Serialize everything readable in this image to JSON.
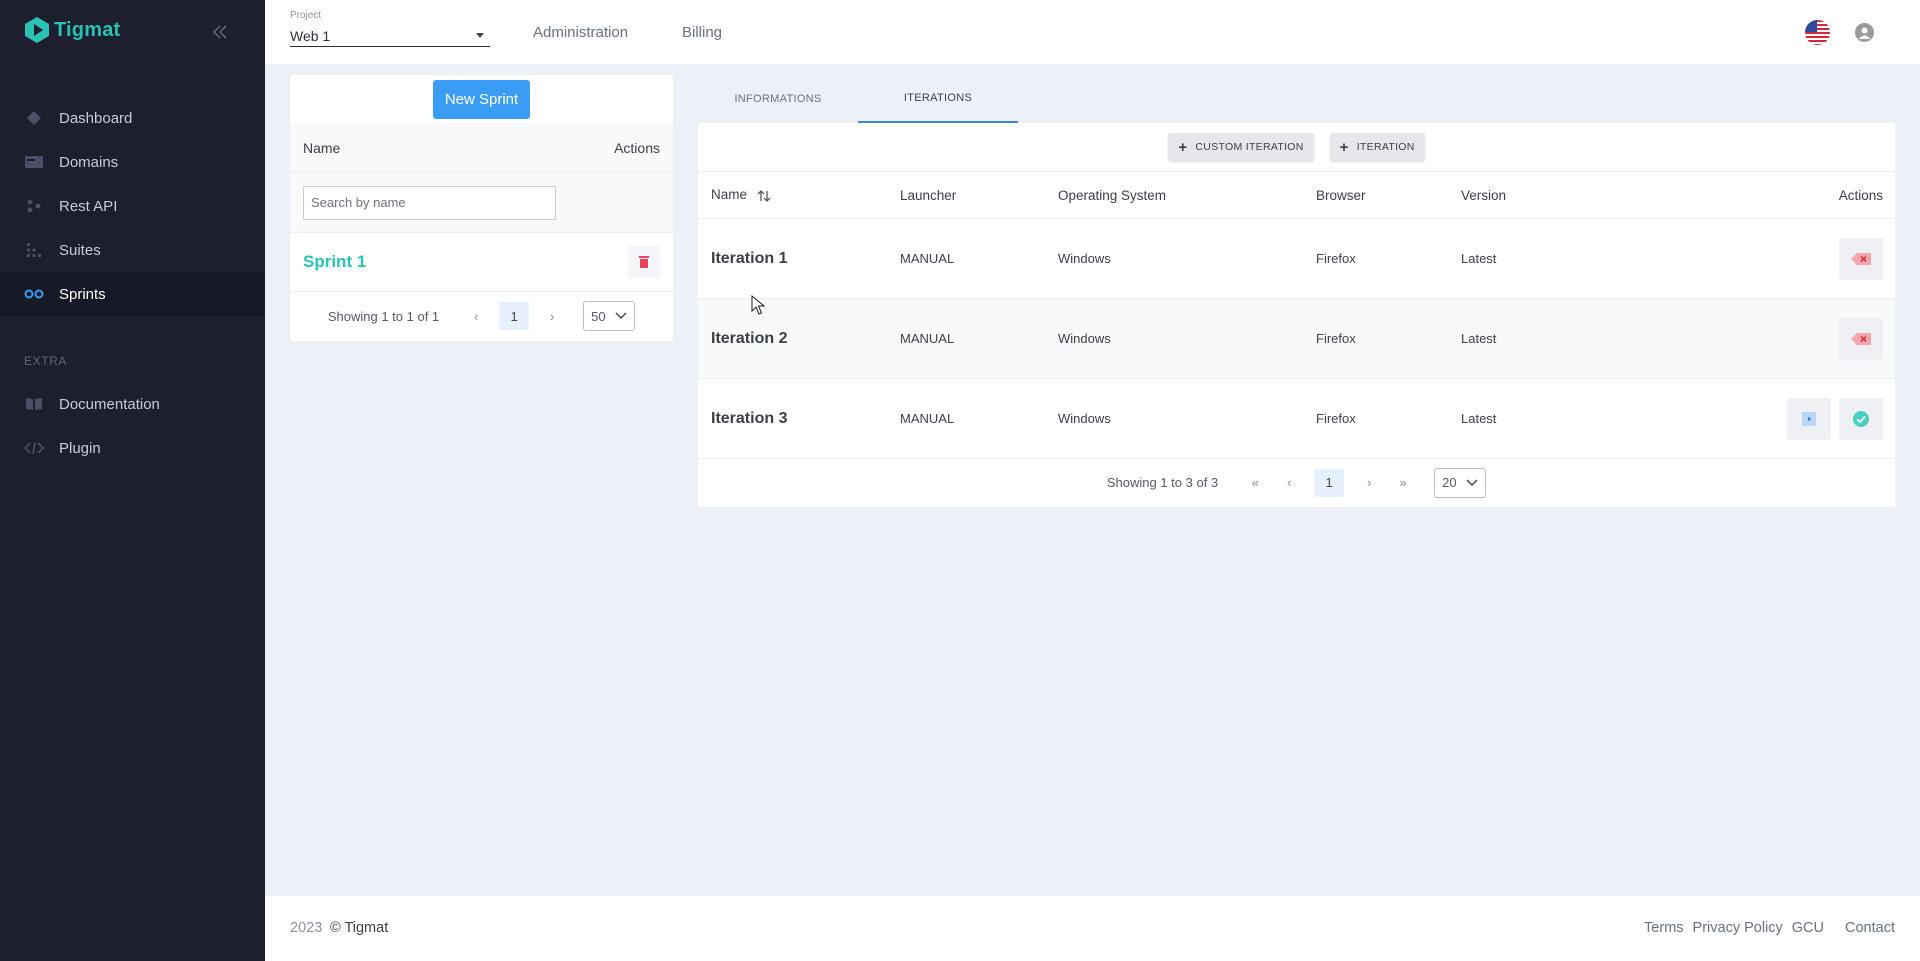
{
  "app": {
    "name": "Tigmat",
    "brand_color": "#2bc1b3",
    "accent_color": "#3b9cf6",
    "danger_color": "#e8435a"
  },
  "sidebar": {
    "items": [
      {
        "label": "Dashboard",
        "icon": "diamond-icon"
      },
      {
        "label": "Domains",
        "icon": "card-icon"
      },
      {
        "label": "Rest API",
        "icon": "nodes-icon"
      },
      {
        "label": "Suites",
        "icon": "dots-grid-icon"
      },
      {
        "label": "Sprints",
        "icon": "infinity-icon",
        "active": true
      }
    ],
    "section_label": "EXTRA",
    "extra_items": [
      {
        "label": "Documentation",
        "icon": "book-icon"
      },
      {
        "label": "Plugin",
        "icon": "code-icon"
      }
    ]
  },
  "header": {
    "project_label": "Project",
    "project_value": "Web 1",
    "links": [
      "Administration",
      "Billing"
    ]
  },
  "sprints_panel": {
    "new_button": "New Sprint",
    "col_name": "Name",
    "col_actions": "Actions",
    "search_placeholder": "Search by name",
    "rows": [
      {
        "name": "Sprint 1"
      }
    ],
    "pager": {
      "text": "Showing 1 to 1 of 1",
      "page": "1",
      "page_size": "50"
    }
  },
  "tabs": [
    "INFORMATIONS",
    "ITERATIONS"
  ],
  "iterations_panel": {
    "buttons": [
      "CUSTOM ITERATION",
      "ITERATION"
    ],
    "columns": [
      "Name",
      "Launcher",
      "Operating System",
      "Browser",
      "Version",
      "Actions"
    ],
    "rows": [
      {
        "name": "Iteration 1",
        "launcher": "MANUAL",
        "os": "Windows",
        "browser": "Firefox",
        "version": "Latest",
        "actions": [
          "remove"
        ]
      },
      {
        "name": "Iteration 2",
        "launcher": "MANUAL",
        "os": "Windows",
        "browser": "Firefox",
        "version": "Latest",
        "actions": [
          "remove"
        ]
      },
      {
        "name": "Iteration 3",
        "launcher": "MANUAL",
        "os": "Windows",
        "browser": "Firefox",
        "version": "Latest",
        "actions": [
          "play",
          "check"
        ]
      }
    ],
    "pager": {
      "text": "Showing 1 to 3 of 3",
      "page": "1",
      "page_size": "20"
    }
  },
  "footer": {
    "year": "2023",
    "copyright": "© Tigmat",
    "links": [
      "Terms",
      "Privacy Policy",
      "GCU",
      "Contact"
    ]
  }
}
